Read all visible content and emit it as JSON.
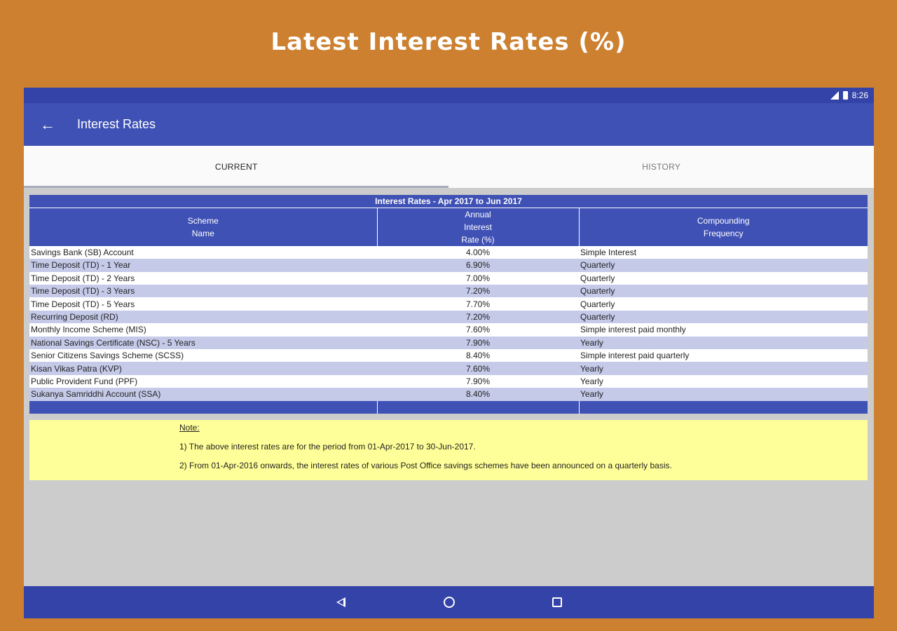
{
  "banner": {
    "title": "Latest Interest Rates (%)"
  },
  "status_bar": {
    "time": "8:26",
    "icons": [
      "signal-icon",
      "battery-icon"
    ]
  },
  "app_bar": {
    "back_icon": "arrow-back-icon",
    "title": "Interest Rates"
  },
  "tabs": [
    {
      "label": "CURRENT",
      "selected": true
    },
    {
      "label": "HISTORY",
      "selected": false
    }
  ],
  "table": {
    "caption": "Interest Rates - Apr 2017 to Jun 2017",
    "headers": [
      [
        "Scheme",
        "Name"
      ],
      [
        "Annual",
        "Interest",
        "Rate (%)"
      ],
      [
        "Compounding",
        "Frequency"
      ]
    ],
    "rows": [
      {
        "scheme": "Savings Bank (SB) Account",
        "rate": "4.00%",
        "frequency": "Simple Interest"
      },
      {
        "scheme": "Time Deposit (TD) - 1 Year",
        "rate": "6.90%",
        "frequency": "Quarterly"
      },
      {
        "scheme": "Time Deposit (TD) - 2 Years",
        "rate": "7.00%",
        "frequency": "Quarterly"
      },
      {
        "scheme": "Time Deposit (TD) - 3 Years",
        "rate": "7.20%",
        "frequency": "Quarterly"
      },
      {
        "scheme": "Time Deposit (TD) - 5 Years",
        "rate": "7.70%",
        "frequency": "Quarterly"
      },
      {
        "scheme": "Recurring Deposit (RD)",
        "rate": "7.20%",
        "frequency": "Quarterly"
      },
      {
        "scheme": "Monthly Income Scheme (MIS)",
        "rate": "7.60%",
        "frequency": "Simple interest paid monthly"
      },
      {
        "scheme": "National Savings Certificate (NSC) - 5 Years",
        "rate": "7.90%",
        "frequency": "Yearly"
      },
      {
        "scheme": "Senior Citizens Savings Scheme (SCSS)",
        "rate": "8.40%",
        "frequency": "Simple interest paid quarterly"
      },
      {
        "scheme": "Kisan Vikas Patra (KVP)",
        "rate": "7.60%",
        "frequency": "Yearly"
      },
      {
        "scheme": "Public Provident Fund (PPF)",
        "rate": "7.90%",
        "frequency": "Yearly"
      },
      {
        "scheme": "Sukanya Samriddhi Account (SSA)",
        "rate": "8.40%",
        "frequency": "Yearly"
      }
    ]
  },
  "note": {
    "title": "Note:",
    "lines": [
      "1) The above interest rates are for the period from 01-Apr-2017 to 30-Jun-2017.",
      "2) From 01-Apr-2016 onwards, the interest rates of various Post Office savings schemes have been announced on a quarterly basis."
    ]
  },
  "nav_bar": {
    "icons": [
      "nav-back-icon",
      "nav-home-icon",
      "nav-recents-icon"
    ]
  },
  "colors": {
    "background": "#cc8030",
    "primary": "#3f51b5",
    "status_bar": "#3443a8",
    "row_alt": "#c5cae9",
    "note_bg": "#ffff99",
    "content_bg": "#cccccc"
  }
}
